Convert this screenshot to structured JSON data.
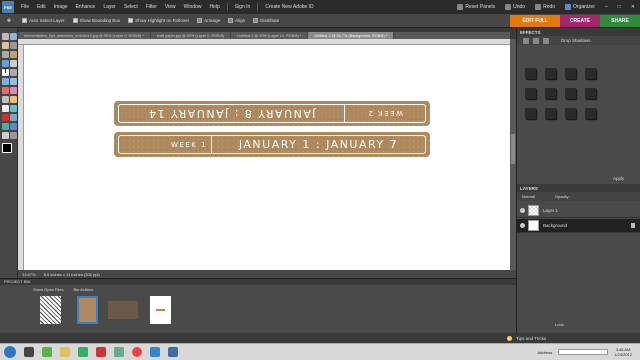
{
  "menu": {
    "logo": "PSE",
    "items": [
      "File",
      "Edit",
      "Image",
      "Enhance",
      "Layer",
      "Select",
      "Filter",
      "View",
      "Window",
      "Help"
    ],
    "sign_in": "Sign In",
    "create_id": "Create New Adobe ID",
    "reset_panels": "Reset Panels",
    "undo": "Undo",
    "redo": "Redo",
    "organizer": "Organizer"
  },
  "options": {
    "auto_select": "Auto Select Layer",
    "bounding_box": "Show Bounding Box",
    "highlight": "Show Highlight on Rollover",
    "arrange": "Arrange",
    "align": "Align",
    "distribute": "Distribute"
  },
  "mode_tabs": {
    "edit": "EDIT FULL",
    "create": "CREATE",
    "share": "SHARE"
  },
  "doc_tabs": [
    "elementsdlea_2jpt_daneclms_vn1cbu14.jpg @ 50% (Layer 0, RGB/8) *",
    "kraft paper.jpg @ 50% (Layer 0, RGB/8)",
    "Untitled-1 @ 50% (Layer 12, RGB/8) *",
    "Untitled-2 @ 33.7% (Background, RGB/8) *"
  ],
  "canvas": {
    "strip1": {
      "left": "WEEK 2",
      "right": "JANUARY 8 : JANUARY 14"
    },
    "strip2": {
      "left": "WEEK 1",
      "right": "JANUARY 1 : JANUARY 7"
    }
  },
  "status": {
    "zoom": "33.67%",
    "doc_size": "8.5 inches x 11 inches (300 ppi)"
  },
  "project_bin": {
    "title": "PROJECT BIN",
    "show": "Show Open Files",
    "bin_actions": "Bin Actions"
  },
  "effects": {
    "title": "EFFECTS",
    "dropdown": "Drop Shadows",
    "apply": "Apply"
  },
  "layers": {
    "title": "LAYERS",
    "blend": "Normal",
    "opacity_label": "Opacity:",
    "lock_label": "Lock:",
    "items": [
      "Layer 1",
      "Background"
    ]
  },
  "tips": "Tips and Tricks",
  "taskbar": {
    "address_label": "Address",
    "time": "3:46 AM",
    "date": "1/24/2012"
  }
}
